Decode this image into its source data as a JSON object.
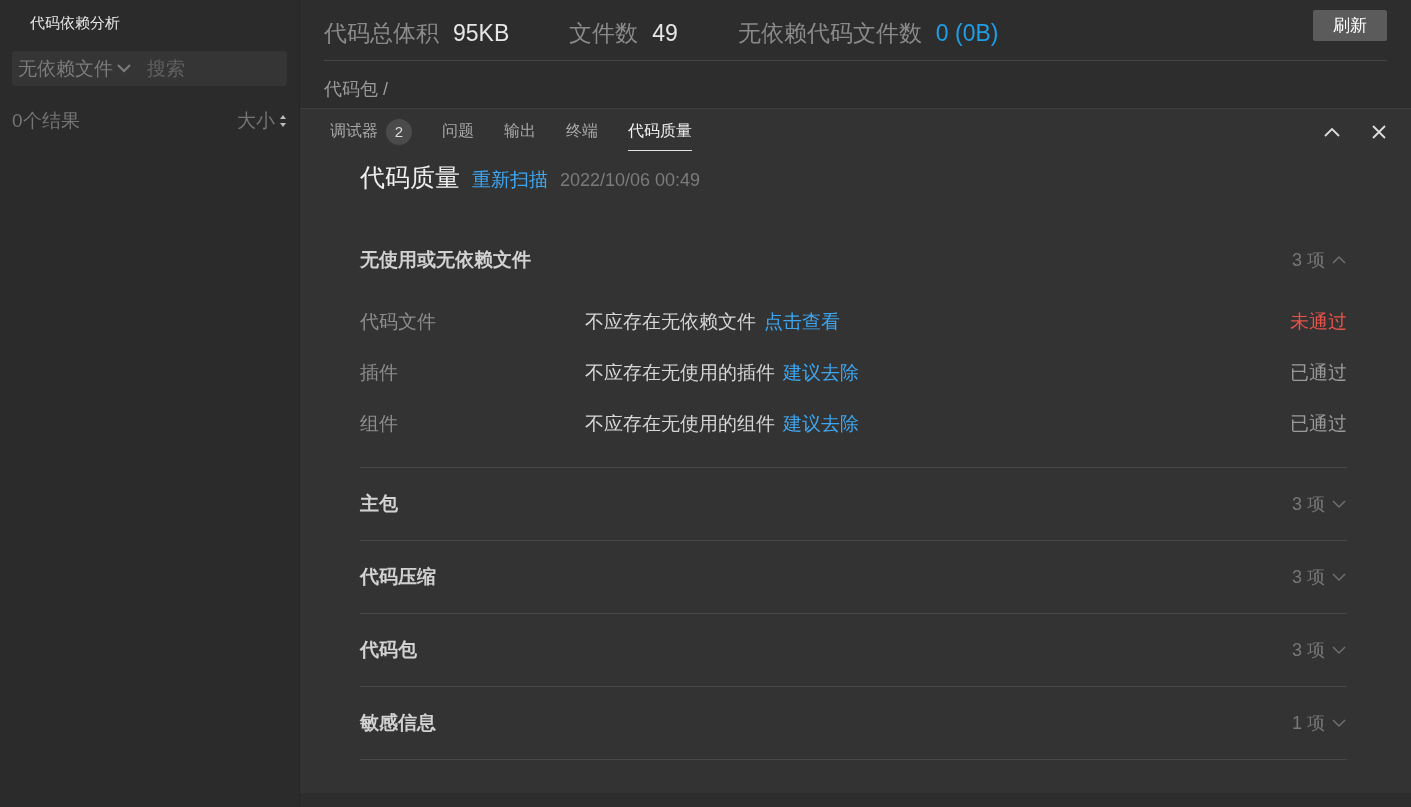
{
  "sidebar": {
    "title": "代码依赖分析",
    "filter": {
      "value": "无依赖文件"
    },
    "search": {
      "placeholder": "搜索"
    },
    "result_count": "0个结果",
    "sort": {
      "label": "大小"
    }
  },
  "summary": {
    "stats": [
      {
        "label": "代码总体积",
        "value": "95KB",
        "kind": "plain"
      },
      {
        "label": "文件数",
        "value": "49",
        "kind": "plain"
      },
      {
        "label": "无依赖代码文件数",
        "value": "0 (0B)",
        "kind": "link"
      }
    ],
    "refresh_button": "刷新",
    "breadcrumb": "代码包 /"
  },
  "panel": {
    "tabs": [
      {
        "label": "调试器",
        "badge": "2",
        "selected": false
      },
      {
        "label": "问题",
        "selected": false
      },
      {
        "label": "输出",
        "selected": false
      },
      {
        "label": "终端",
        "selected": false
      },
      {
        "label": "代码质量",
        "selected": true
      }
    ],
    "title": "代码质量",
    "rescan_link": "重新扫描",
    "timestamp": "2022/10/06 00:49",
    "sections": [
      {
        "title": "无使用或无依赖文件",
        "count": "3 项",
        "expanded": true,
        "rows": [
          {
            "name": "代码文件",
            "rule": "不应存在无依赖文件",
            "action": "点击查看",
            "status": "未通过",
            "passed": false
          },
          {
            "name": "插件",
            "rule": "不应存在无使用的插件",
            "action": "建议去除",
            "status": "已通过",
            "passed": true
          },
          {
            "name": "组件",
            "rule": "不应存在无使用的组件",
            "action": "建议去除",
            "status": "已通过",
            "passed": true
          }
        ]
      },
      {
        "title": "主包",
        "count": "3 项",
        "expanded": false
      },
      {
        "title": "代码压缩",
        "count": "3 项",
        "expanded": false
      },
      {
        "title": "代码包",
        "count": "3 项",
        "expanded": false
      },
      {
        "title": "敏感信息",
        "count": "1 项",
        "expanded": false
      }
    ]
  }
}
